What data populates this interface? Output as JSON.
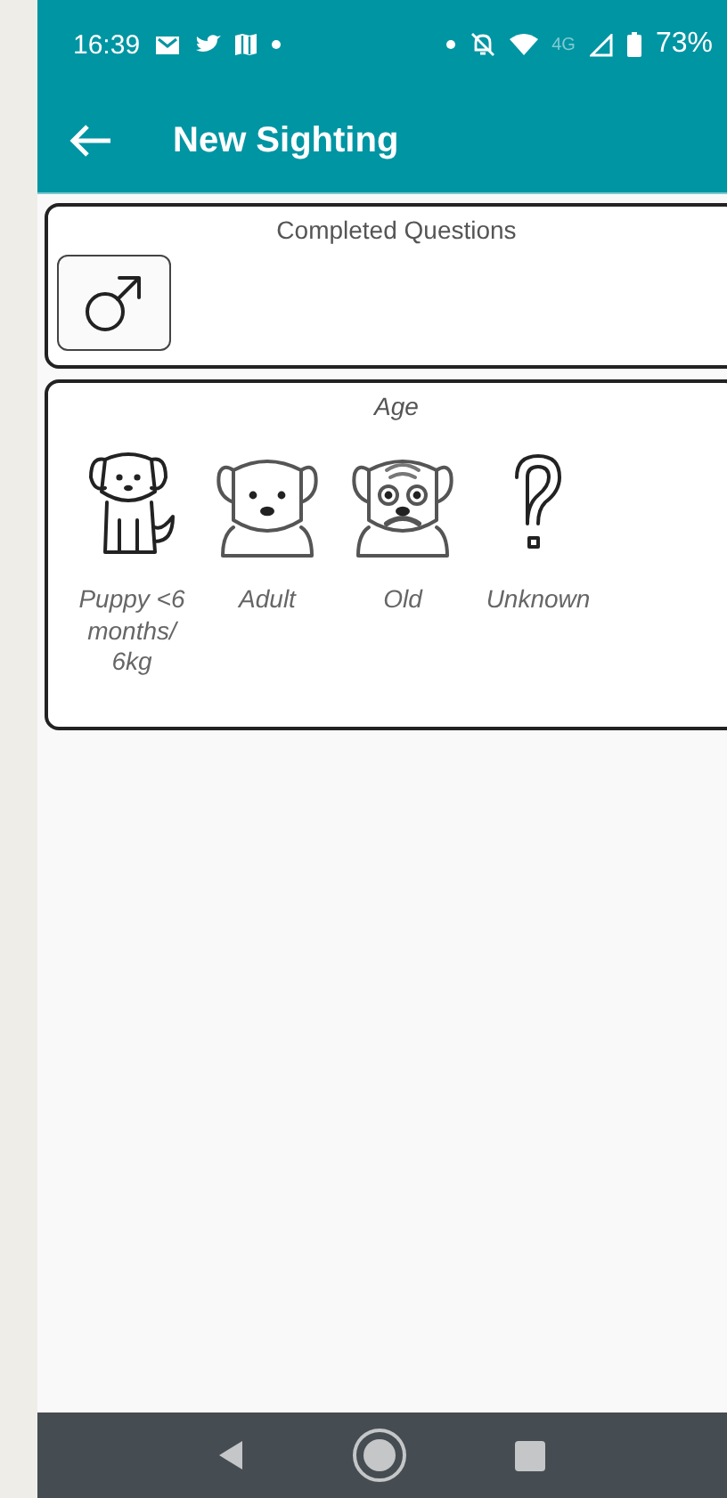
{
  "status_bar": {
    "time": "16:39",
    "network": "4G",
    "battery": "73%"
  },
  "app_bar": {
    "title": "New Sighting"
  },
  "completed": {
    "title": "Completed Questions",
    "answers": [
      {
        "kind": "male"
      }
    ]
  },
  "question": {
    "title": "Age",
    "options": [
      {
        "kind": "puppy",
        "label": "Puppy <6 months/ 6kg"
      },
      {
        "kind": "adult",
        "label": "Adult"
      },
      {
        "kind": "old",
        "label": "Old"
      },
      {
        "kind": "unknown",
        "label": "Unknown"
      }
    ]
  }
}
